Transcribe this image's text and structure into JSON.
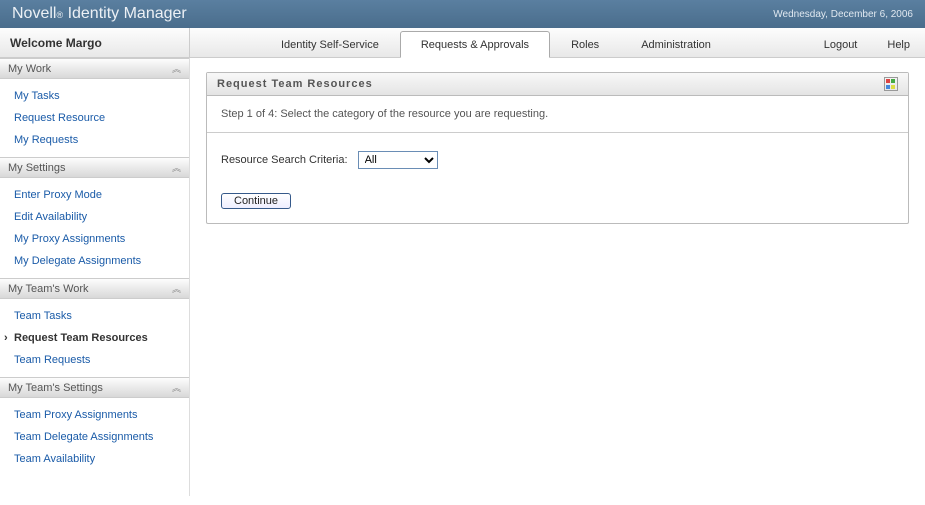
{
  "banner": {
    "title_prefix": "Novell",
    "title_suffix": "Identity Manager",
    "date": "Wednesday, December 6, 2006"
  },
  "welcome": "Welcome Margo",
  "tabs": {
    "items": [
      "Identity Self-Service",
      "Requests & Approvals",
      "Roles",
      "Administration"
    ],
    "right": [
      "Logout",
      "Help"
    ],
    "active_index": 1
  },
  "sidebar": {
    "sections": [
      {
        "title": "My Work",
        "links": [
          "My Tasks",
          "Request Resource",
          "My Requests"
        ],
        "active_index": -1
      },
      {
        "title": "My Settings",
        "links": [
          "Enter Proxy Mode",
          "Edit Availability",
          "My Proxy Assignments",
          "My Delegate Assignments"
        ],
        "active_index": -1
      },
      {
        "title": "My Team's Work",
        "links": [
          "Team Tasks",
          "Request Team Resources",
          "Team Requests"
        ],
        "active_index": 1
      },
      {
        "title": "My Team's Settings",
        "links": [
          "Team Proxy Assignments",
          "Team Delegate Assignments",
          "Team Availability"
        ],
        "active_index": -1
      }
    ]
  },
  "panel": {
    "title": "Request Team Resources",
    "step_text": "Step 1 of 4: Select the category of the resource you are requesting.",
    "criteria_label": "Resource Search Criteria:",
    "criteria_value": "All",
    "continue_label": "Continue"
  }
}
